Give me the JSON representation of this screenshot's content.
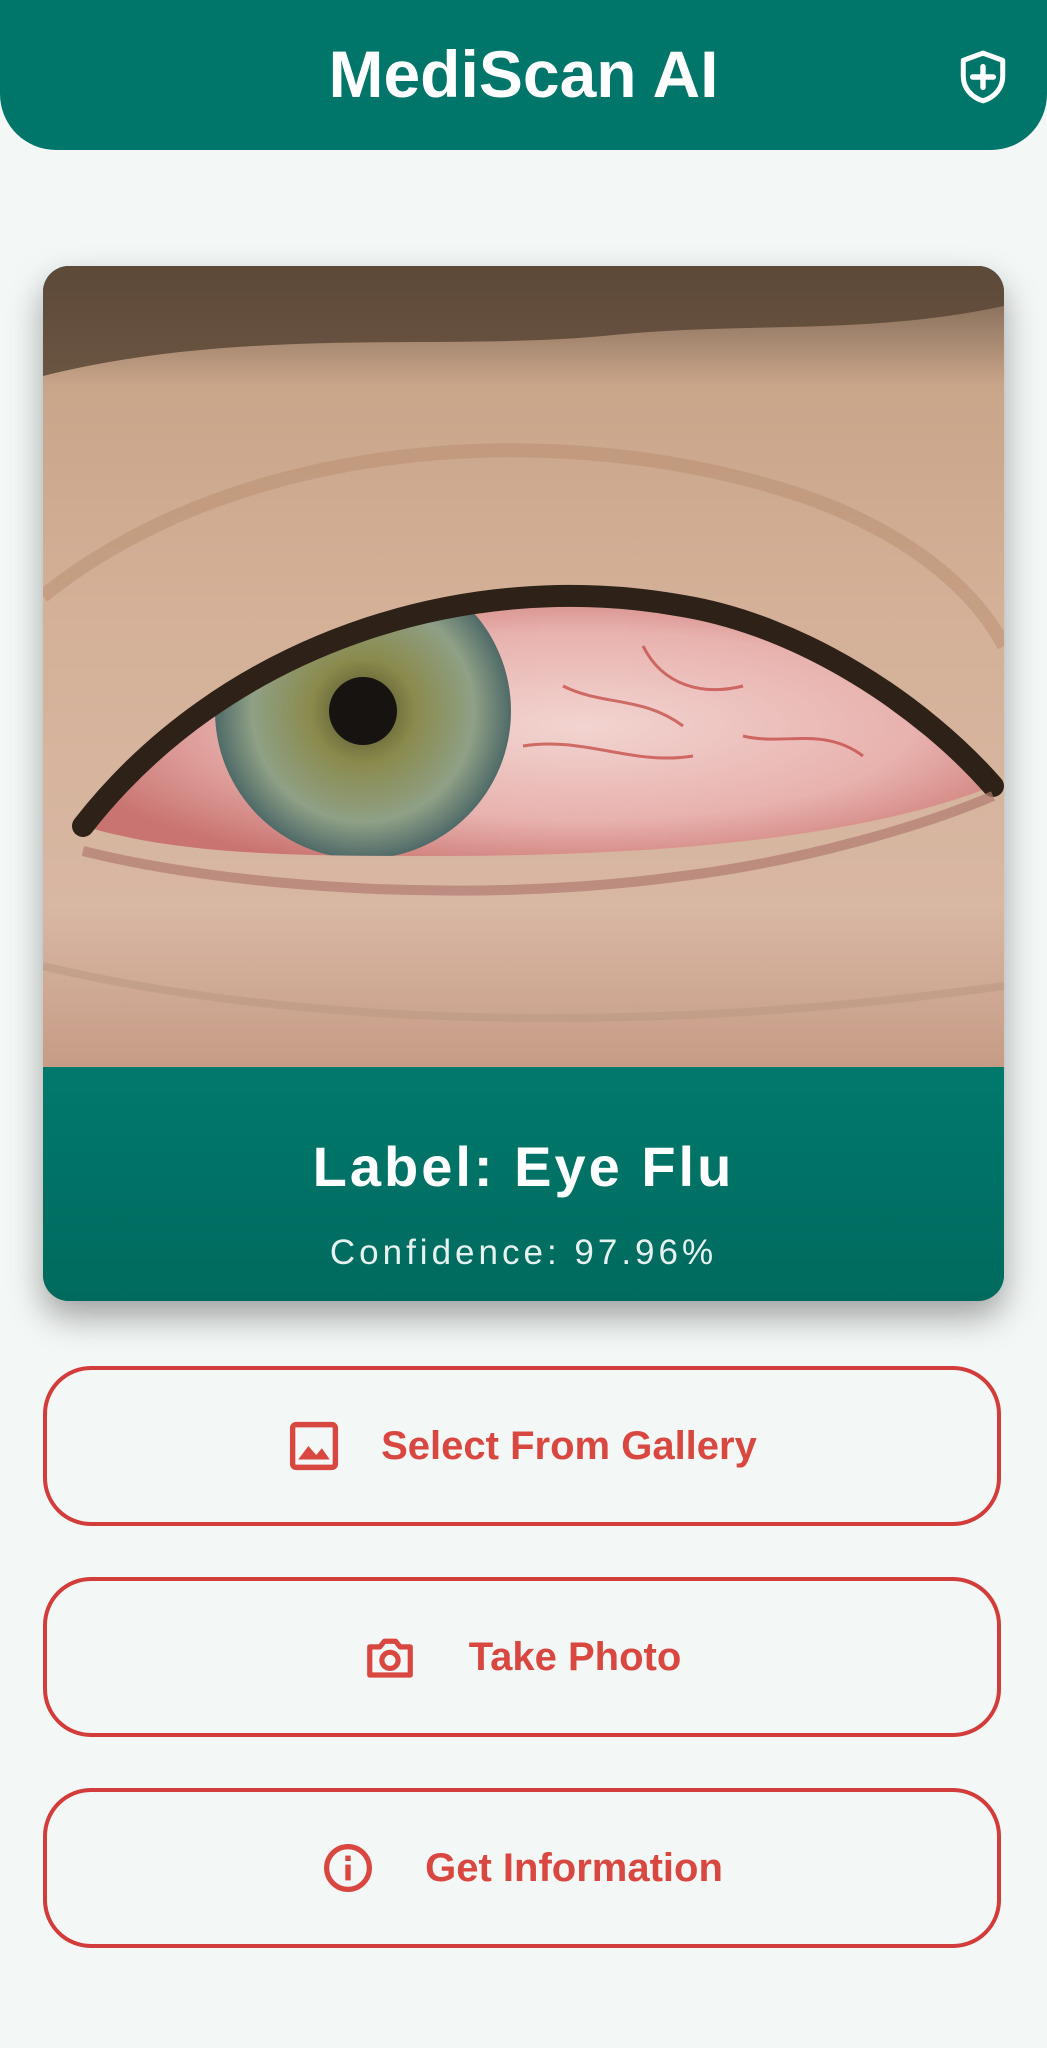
{
  "app": {
    "title": "MediScan AI",
    "brand_color": "#00766a",
    "accent_color": "#d23c3a",
    "icon": "shield-plus-icon"
  },
  "result": {
    "label": "Label: Eye Flu",
    "confidence": "Confidence: 97.96%"
  },
  "actions": [
    {
      "label": "Select From Gallery",
      "icon": "image-icon"
    },
    {
      "label": "Take Photo",
      "icon": "camera-icon"
    },
    {
      "label": "Get Information",
      "icon": "info-icon"
    }
  ]
}
